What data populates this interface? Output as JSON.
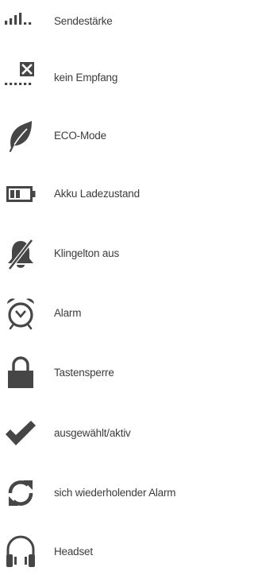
{
  "legend": {
    "items": [
      {
        "icon": "signal-strength-icon",
        "label": "Sendestärke"
      },
      {
        "icon": "no-reception-icon",
        "label": "kein Empfang"
      },
      {
        "icon": "leaf-icon",
        "label": "ECO-Mode"
      },
      {
        "icon": "battery-icon",
        "label": "Akku Ladezustand"
      },
      {
        "icon": "bell-off-icon",
        "label": "Klingelton aus"
      },
      {
        "icon": "alarm-clock-icon",
        "label": "Alarm"
      },
      {
        "icon": "padlock-icon",
        "label": "Tastensperre"
      },
      {
        "icon": "checkmark-icon",
        "label": "ausgewählt/aktiv"
      },
      {
        "icon": "repeat-icon",
        "label": "sich wiederholender Alarm"
      },
      {
        "icon": "headset-icon",
        "label": "Headset"
      }
    ]
  },
  "colors": {
    "icon": "#464646",
    "text": "#3c3c3c"
  }
}
